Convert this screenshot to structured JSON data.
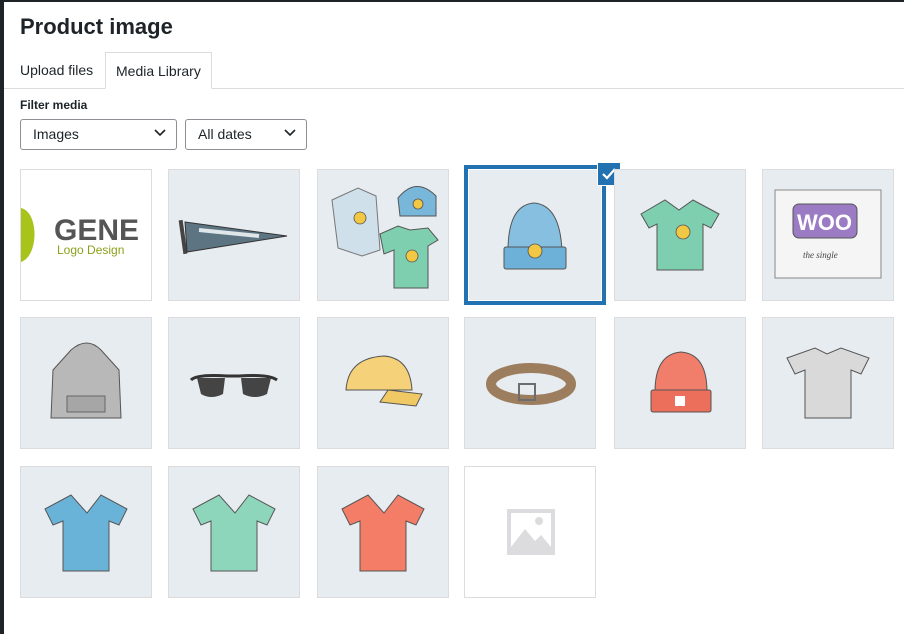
{
  "modal": {
    "title": "Product image"
  },
  "tabs": [
    {
      "label": "Upload files",
      "active": false
    },
    {
      "label": "Media Library",
      "active": true
    }
  ],
  "filter": {
    "label": "Filter media",
    "type_selected": "Images",
    "date_selected": "All dates"
  },
  "logo_text": {
    "main": "GENE",
    "sub": "Logo Design"
  },
  "woo_text": {
    "main": "WOO",
    "sub": "the single"
  },
  "media_items": [
    {
      "name": "logo",
      "selected": false
    },
    {
      "name": "pennant",
      "selected": false
    },
    {
      "name": "hoodie-with-logo-set",
      "selected": false
    },
    {
      "name": "beanie-with-logo",
      "selected": true
    },
    {
      "name": "v-neck-t-shirt-green",
      "selected": false
    },
    {
      "name": "single-woo",
      "selected": false
    },
    {
      "name": "hoodie",
      "selected": false
    },
    {
      "name": "sunglasses",
      "selected": false
    },
    {
      "name": "cap",
      "selected": false
    },
    {
      "name": "belt",
      "selected": false
    },
    {
      "name": "beanie-red",
      "selected": false
    },
    {
      "name": "t-shirt-gray",
      "selected": false
    },
    {
      "name": "v-neck-t-shirt-blue",
      "selected": false
    },
    {
      "name": "v-neck-t-shirt-green",
      "selected": false
    },
    {
      "name": "v-neck-t-shirt-red",
      "selected": false
    },
    {
      "name": "placeholder",
      "selected": false
    }
  ],
  "colors": {
    "accent": "#2271b1",
    "tile_bg": "#e7ecf0"
  }
}
